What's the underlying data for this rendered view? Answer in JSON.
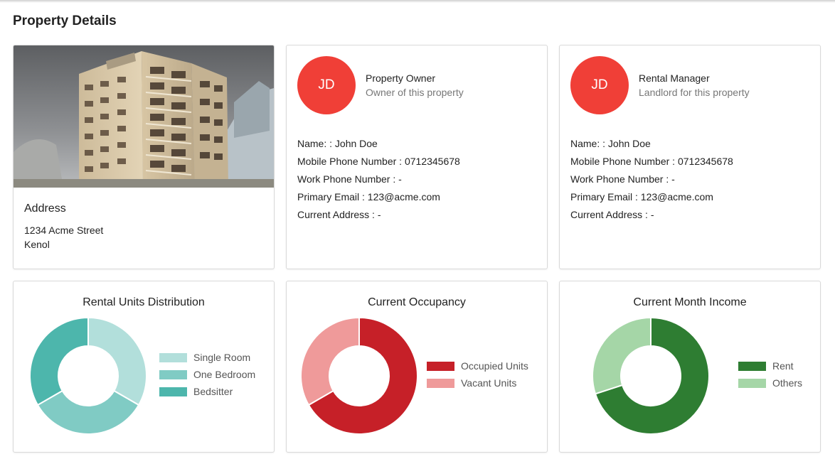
{
  "page": {
    "title": "Property Details"
  },
  "property": {
    "image_alt": "building-photo",
    "address_title": "Address",
    "address_lines": [
      "1234 Acme Street",
      "Kenol"
    ]
  },
  "owner": {
    "initials": "JD",
    "role": "Property Owner",
    "subtitle": "Owner of this property",
    "details": [
      "Name: : John Doe",
      "Mobile Phone Number : 0712345678",
      "Work Phone Number : -",
      "Primary Email : 123@acme.com",
      "Current Address : -"
    ]
  },
  "manager": {
    "initials": "JD",
    "role": "Rental Manager",
    "subtitle": "Landlord for this property",
    "details": [
      "Name: : John Doe",
      "Mobile Phone Number : 0712345678",
      "Work Phone Number : -",
      "Primary Email : 123@acme.com",
      "Current Address : -"
    ]
  },
  "colors": {
    "avatar": "#f03f37",
    "single_room": "#b2dfdb",
    "one_bedroom": "#80cbc4",
    "bedsitter": "#4db6ac",
    "occupied": "#c62028",
    "vacant": "#ef9a9a",
    "rent": "#2e7d32",
    "others": "#a5d6a7"
  },
  "chart_data": [
    {
      "type": "pie",
      "variant": "doughnut",
      "title": "Rental Units Distribution",
      "categories": [
        "Single Room",
        "One Bedroom",
        "Bedsitter"
      ],
      "values": [
        1,
        1,
        1
      ],
      "colors": [
        "#b2dfdb",
        "#80cbc4",
        "#4db6ac"
      ],
      "legend": "right"
    },
    {
      "type": "pie",
      "variant": "doughnut",
      "title": "Current Occupancy",
      "categories": [
        "Occupied Units",
        "Vacant Units"
      ],
      "values": [
        2,
        1
      ],
      "colors": [
        "#c62028",
        "#ef9a9a"
      ],
      "legend": "right"
    },
    {
      "type": "pie",
      "variant": "doughnut",
      "title": "Current Month Income",
      "categories": [
        "Rent",
        "Others"
      ],
      "values": [
        70,
        30
      ],
      "colors": [
        "#2e7d32",
        "#a5d6a7"
      ],
      "legend": "right"
    }
  ]
}
